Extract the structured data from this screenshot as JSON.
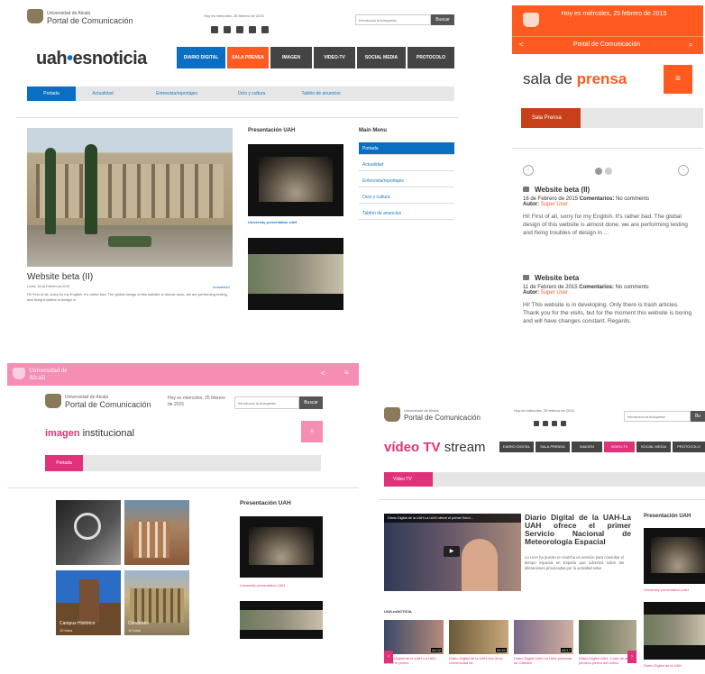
{
  "colors": {
    "blue": "#0a6fc2",
    "orange": "#ff5a1f",
    "pink": "#f58db5",
    "magenta": "#e0317b",
    "dark": "#333333"
  },
  "p1": {
    "header": {
      "uni": "Universidad de Alcalá",
      "portal": "Portal de Comunicación",
      "date": "Hoy es miércoles, 25 febrero de 2015",
      "search_placeholder": "Introduzca la búsqueda",
      "search_button": "Buscar"
    },
    "logo": {
      "a": "uah",
      "b": "esnoticia"
    },
    "nav": [
      "DIARIO DIGITAL",
      "SALA PRENSA",
      "IMAGEN",
      "VIDEO-TV",
      "SOCIAL MEDIA",
      "PROTOCOLO"
    ],
    "tabs": [
      "Portada",
      "Actualidad",
      "Entrevista/reportajes",
      "Ocio y cultura",
      "Tablón de anuncios"
    ],
    "article": {
      "title": "Website beta (II)",
      "meta": "Lunes, 16 de Febrero de 2015",
      "category": "Actualidad",
      "body": "Hi! First of all, sorry for my English. It's rather bad. The global design of this website is almost done, we are performing testing and fixing troubles of design in"
    },
    "presentacion": {
      "heading": "Presentación UAH",
      "caption": "University presentation UAH"
    },
    "menu": {
      "heading": "Main Menu",
      "items": [
        "Portada",
        "Actualidad",
        "Entrevista/reportajes",
        "Ocio y cultura",
        "Tablón de anuncios"
      ]
    }
  },
  "p2": {
    "date": "Hoy es miércoles, 25 febrero de 2015",
    "portal": "Portal de Comunicación",
    "title_a": "sala de",
    "title_b": "prensa",
    "tab": "Sala Prensa",
    "posts": [
      {
        "title": "Website beta (II)",
        "meta_date": "16 de Febrero de 2015",
        "comments_label": "Comentarios:",
        "comments": "No comments",
        "author_label": "Autor:",
        "author": "Super User",
        "body": "Hi! First of all, sorry for my English. It's rather bad. The global design of this website is almost done, we are performing testing and fixing troubles of design in ..."
      },
      {
        "title": "Website beta",
        "meta_date": "11 de Febrero de 2015",
        "comments_label": "Comentarios:",
        "comments": "No comments",
        "author_label": "Autor:",
        "author": "Super User",
        "body": "Hi! This website is in developing. Only there is trash articles. Thank you for the visits, but for the moment this website is boring and will have changes constant. Regards."
      }
    ]
  },
  "p3": {
    "brand": "Universidad de Alcalá",
    "header": {
      "uni": "Universidad de Alcalá",
      "portal": "Portal de Comunicación",
      "date": "Hoy es miércoles, 25 febrero de 2015",
      "search_placeholder": "Introduzca la búsqueda",
      "search_button": "Buscar"
    },
    "title_a": "imagen",
    "title_b": "institucional",
    "tab": "Portada",
    "tiles": [
      {
        "title": "",
        "sub": ""
      },
      {
        "title": "",
        "sub": ""
      },
      {
        "title": "Campus Histórico",
        "sub": "10 fotos"
      },
      {
        "title": "Cervantes",
        "sub": "11 fotos"
      }
    ],
    "presentacion": {
      "heading": "Presentación UAH",
      "caption": "University presentation UAH"
    }
  },
  "p4": {
    "header": {
      "uni": "Universidad de Alcalá",
      "portal": "Portal de Comunicación",
      "date": "Hoy es miércoles, 25 febrero de 2015",
      "search_placeholder": "Introduzca la búsqueda",
      "search_button": "Bu"
    },
    "title_a": "vídeo TV",
    "title_b": "stream",
    "nav": [
      "DIARIO DIGITAL",
      "SALA PRENSA",
      "IMAGEN",
      "VIDEO-TV",
      "SOCIAL MEDIA",
      "PROTOCOLO"
    ],
    "tab": "Vídeo TV",
    "video_bar": "Diario Digital de la UAH-La UAH ofrece el primer Servi...",
    "article": {
      "title": "Diario Digital de la UAH-La UAH ofrece el primer Servicio Nacional de Meteorología Espacial",
      "body": "La UAH ha puesto en marcha un servicio para consultar el tiempo espacial en España que advertirá sobre las alteraciones provocadas por la actividad solar"
    },
    "presentacion": {
      "heading": "Presentación UAH",
      "caption": "University presentation UAH"
    },
    "section": "UAH.esNOTICIA",
    "thumbs": [
      {
        "time": "04:02",
        "cap": "Diario Digital de la UAH-La UAH ofrece el primer"
      },
      {
        "time": "05:52",
        "cap": "Diario Digital de la UAH-Día de la Universidad de"
      },
      {
        "time": "05:17",
        "cap": "Diario Digital UAH-La UAH presenta su Cátedra"
      },
      {
        "time": "",
        "cap": "Diario Digital UAH- Corte de la primera piedra del nuevo"
      }
    ],
    "caption2": "Diario Digital de la UAH"
  }
}
